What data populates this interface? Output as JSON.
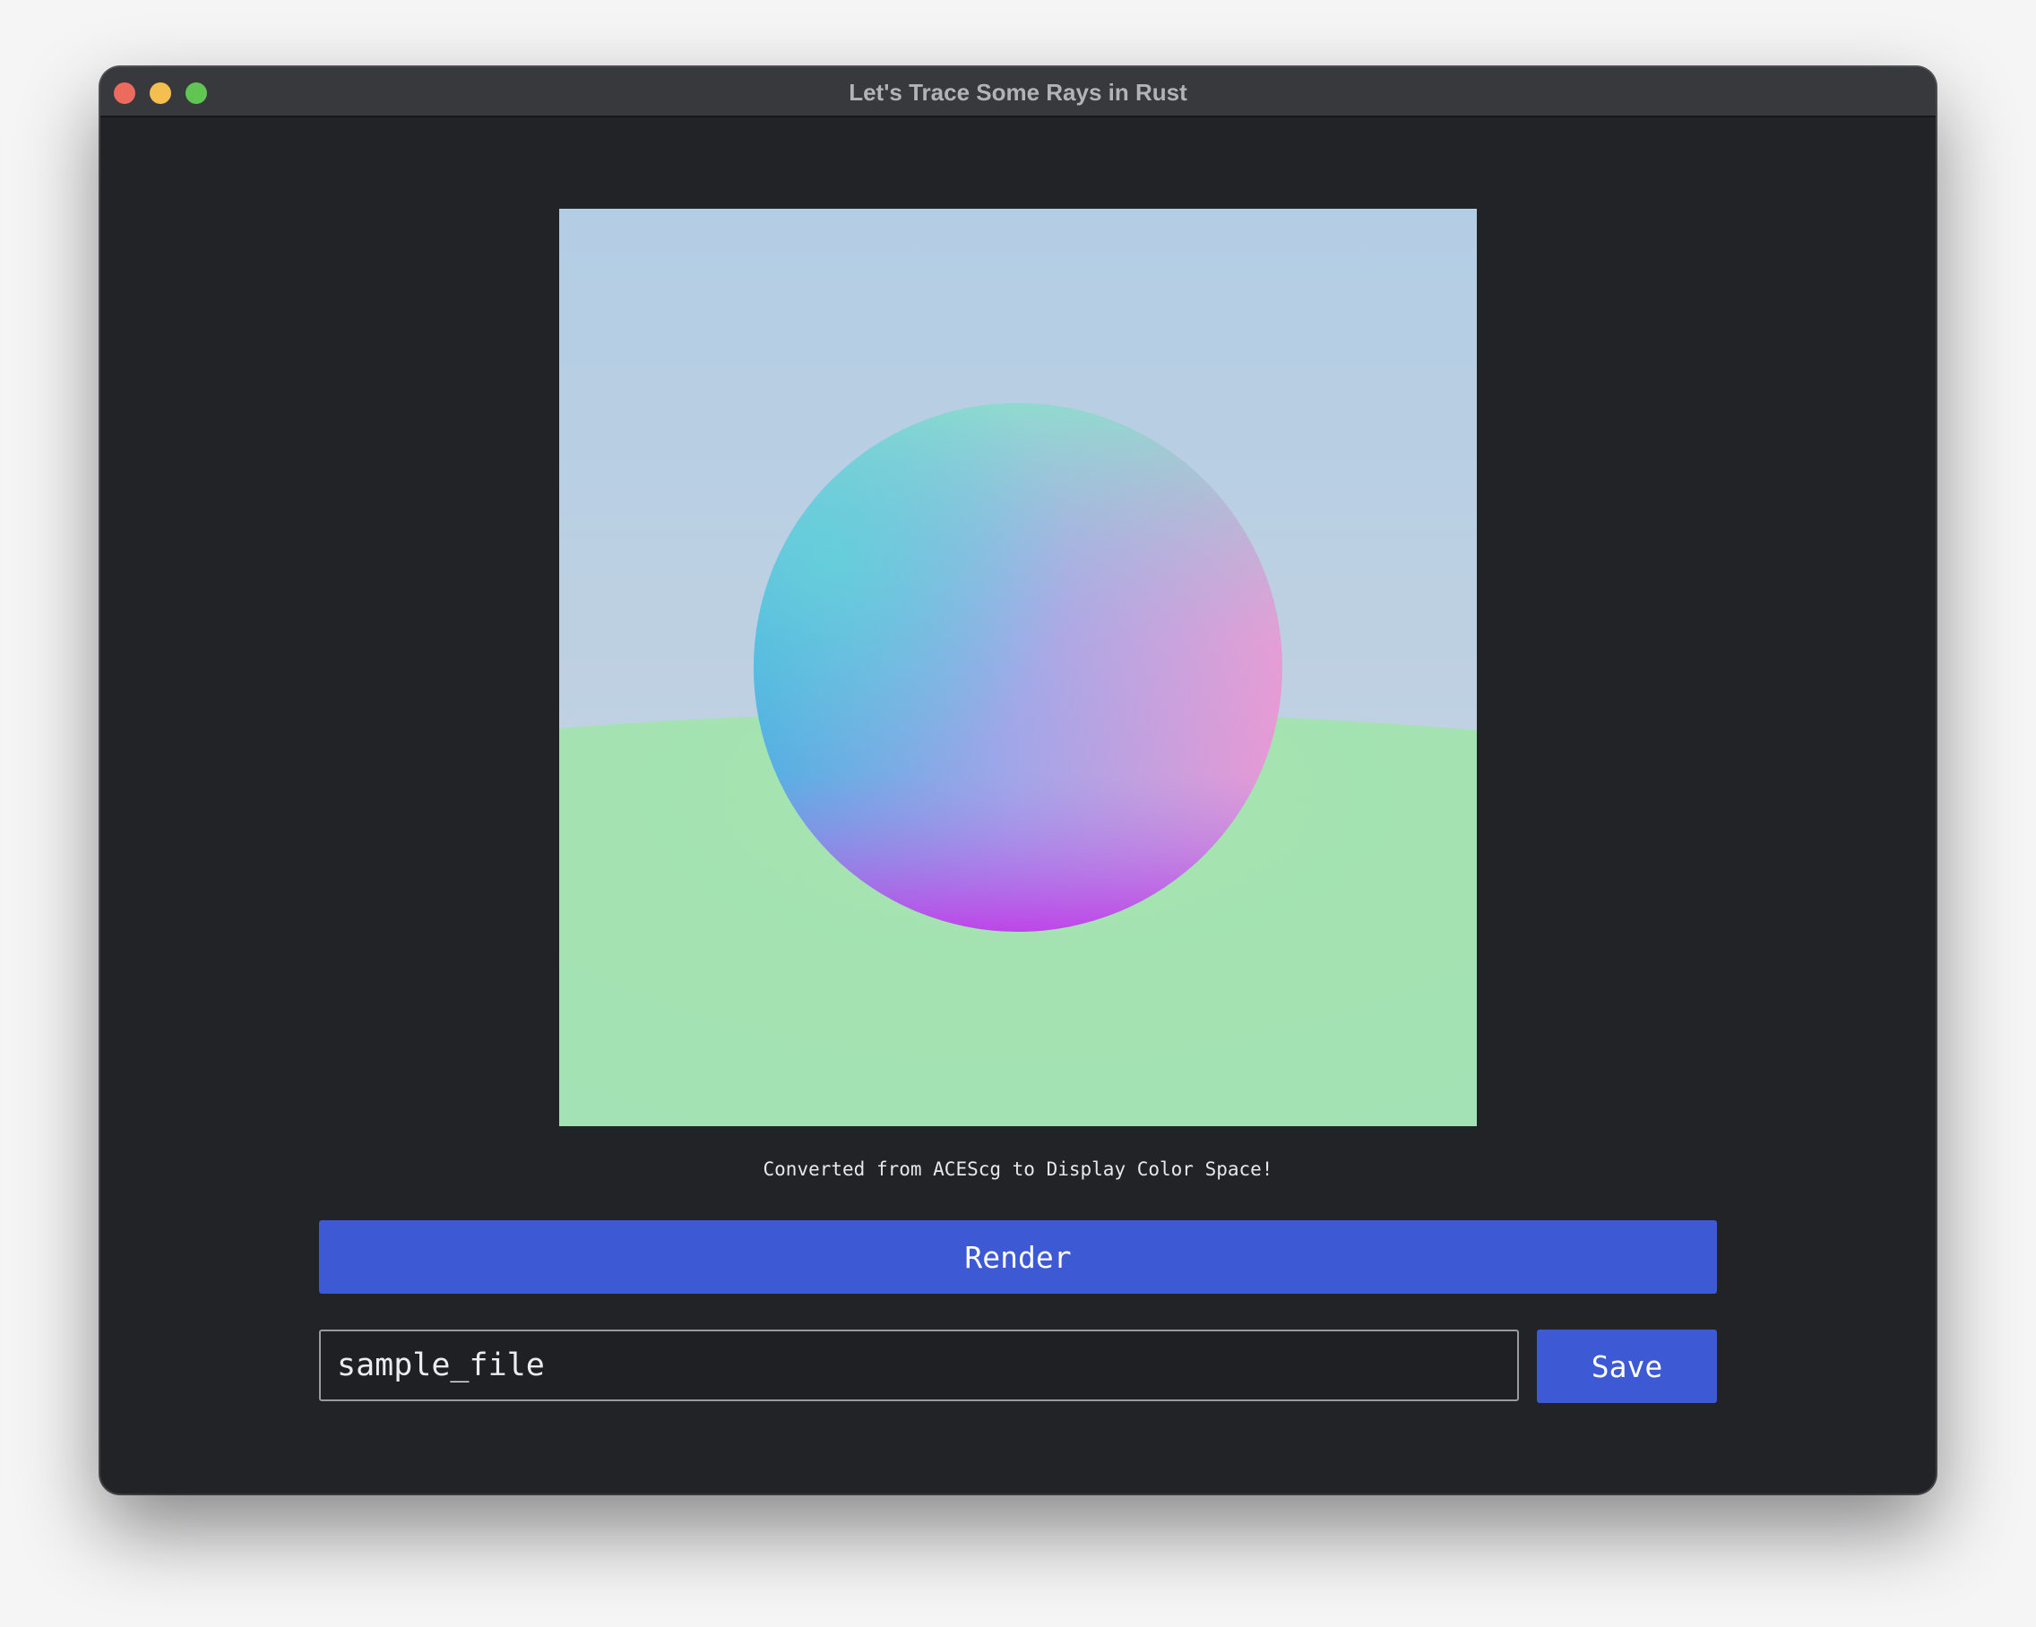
{
  "window": {
    "title": "Let's Trace Some Rays in Rust"
  },
  "traffic_lights": {
    "close_color": "#ed6a5e",
    "minimize_color": "#f5bf4f",
    "maximize_color": "#61c554"
  },
  "render": {
    "sky_top_color": "#b3cde4",
    "sky_horizon_color": "#c8d4e0",
    "ground_color": "#a4e3b2",
    "sphere_colors": {
      "top": "#8ee0cc",
      "left": "#48b0e2",
      "right": "#f09ad2",
      "bottom": "#c040e8",
      "center": "#a2a8e8"
    }
  },
  "caption": "Converted from ACEScg to Display Color Space!",
  "actions": {
    "render_label": "Render",
    "save_label": "Save"
  },
  "file": {
    "name_value": "sample_file"
  },
  "colors": {
    "accent": "#3d59d4",
    "background": "#222327"
  }
}
